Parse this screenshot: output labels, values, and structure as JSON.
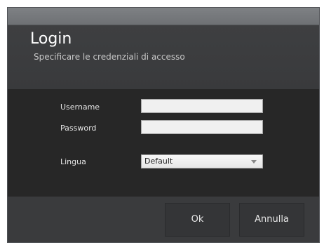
{
  "dialog": {
    "title": "Login",
    "subtitle": "Specificare le credenziali di accesso"
  },
  "form": {
    "username_label": "Username",
    "username_value": "",
    "password_label": "Password",
    "password_value": "",
    "language_label": "Lingua",
    "language_value": "Default"
  },
  "buttons": {
    "ok_label": "Ok",
    "cancel_label": "Annulla"
  },
  "colors": {
    "header_bg": "#3e3f41",
    "body_bg": "#272727",
    "footer_bg": "#3a3b3d",
    "title_text": "#ffffff"
  }
}
